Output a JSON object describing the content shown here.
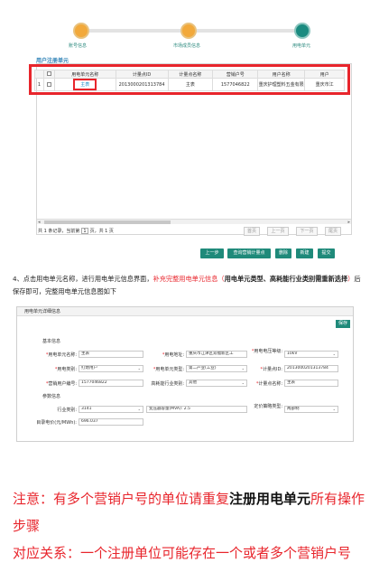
{
  "steps": [
    {
      "label": "账号信息"
    },
    {
      "label": "市场成员信息"
    },
    {
      "label": "用电单元"
    }
  ],
  "registration": {
    "title": "用户注册单元",
    "headers": [
      "",
      "",
      "用电单元名称",
      "计量点ID",
      "计量点名称",
      "营销户号",
      "用户名称",
      "用户"
    ],
    "row": {
      "index": "1",
      "name": "主表",
      "meter_id": "2013000201313784",
      "meter_name": "主表",
      "account": "1577046822",
      "user_name": "重庆护理塑料五金有限",
      "user": "重庆市江"
    },
    "pager": {
      "text_before": "共 1 条记录，当前第",
      "page": "1",
      "text_after": "页，共 1 页"
    },
    "pager_buttons": [
      "首页",
      "上一页",
      "下一页",
      "尾页"
    ],
    "actions": [
      "上一步",
      "查询营销计量点",
      "删除",
      "新建",
      "提交"
    ]
  },
  "instruction": {
    "prefix": "4、点击用电单元名称，进行用电单元信息界面，",
    "red": "补充完整用电单元信息（",
    "bold": "用电单元类型、高耗能行业类别需重新选择",
    "red_end": "）",
    "suffix": "后保存即可，完整用电单元信息图如下"
  },
  "detail": {
    "title": "用电单元详细信息",
    "save": "保存",
    "section_basic": "基本信息",
    "section_params": "参数信息",
    "fields": {
      "unit_name_label": "用电单元名称:",
      "unit_name": "主表",
      "address_label": "用电地址:",
      "address": "重庆市江津区双福新区工",
      "voltage_label": "用电电压等级:",
      "voltage": "10kV",
      "category_label": "用电类别:",
      "category": "打燃用户",
      "industry_label": "用电单元类型:",
      "industry": "第二产业(工业)",
      "meter_id_label": "计量点ID:",
      "meter_id": "2013000201313784",
      "account_label": "营销用户编号:",
      "account": "1577046822",
      "high_label": "高耗能行业类别:",
      "high": "其他",
      "meter_name_label": "计量点名称:",
      "meter_name": "主表",
      "trade_label": "行业类别:",
      "trade": "3141",
      "capacity_label": "变压器容量(MVA):",
      "capacity": "2.5",
      "pricing_label": "定价策略类型:",
      "pricing": "两部制",
      "base_label": "目录电价(元/MWh):",
      "base": "696.037"
    }
  },
  "notes": {
    "line1_red_a": "注意：有多个营销户号的单位请重复",
    "line1_bold": "注册用电单元",
    "line1_red_b": "所有操作",
    "line2": "步骤",
    "line3": "对应关系：一个注册单位可能存在一个或者多个营销户号"
  },
  "colors": {
    "accent": "#1f8a7a",
    "highlight": "#e8252c",
    "step_done": "#f2a93b"
  }
}
